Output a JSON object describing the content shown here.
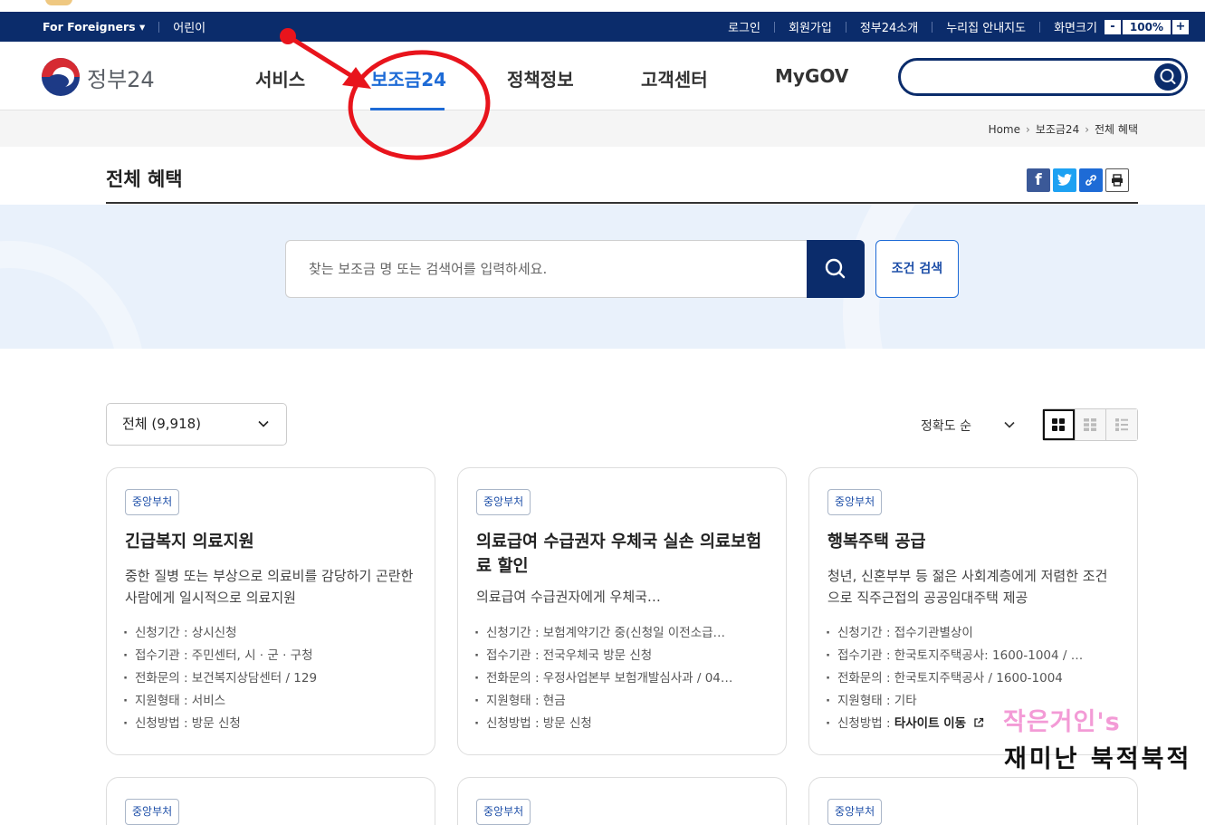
{
  "util_bar": {
    "foreigners": "For Foreigners ▾",
    "kids": "어린이",
    "login": "로그인",
    "signup": "회원가입",
    "about": "정부24소개",
    "sitemap": "누리집 안내지도",
    "zoom_label": "화면크기",
    "zoom_minus": "-",
    "zoom_value": "100%",
    "zoom_plus": "+"
  },
  "header": {
    "logo_text": "정부24",
    "menu": [
      "서비스",
      "보조금24",
      "정책정보",
      "고객센터",
      "MyGOV"
    ],
    "active_index": 1
  },
  "breadcrumb": {
    "home": "Home",
    "level1": "보조금24",
    "level2": "전체 혜택"
  },
  "page_title": "전체 혜택",
  "search": {
    "placeholder": "찾는 보조금 명 또는 검색어를 입력하세요.",
    "cond_button": "조건 검색"
  },
  "filter": {
    "category_selected": "전체 (9,918)",
    "sort_selected": "정확도 순"
  },
  "cards": [
    {
      "badge": "중앙부처",
      "title": "긴급복지 의료지원",
      "desc": "중한 질병 또는 부상으로 의료비를 감당하기 곤란한 사람에게 일시적으로 의료지원",
      "period": "신청기간 : 상시신청",
      "agency": "접수기관 : 주민센터, 시 · 군 · 구청",
      "phone": "전화문의 : 보건복지상담센터 / 129",
      "type": "지원형태 : 서비스",
      "method": "신청방법 : 방문 신청"
    },
    {
      "badge": "중앙부처",
      "title": "의료급여 수급권자 우체국 실손 의료보험료 할인",
      "desc": "의료급여 수급권자에게 우체국…",
      "period": "신청기간 : 보험계약기간 중(신청일 이전소급…",
      "agency": "접수기관 : 전국우체국 방문 신청",
      "phone": "전화문의 : 우정사업본부 보험개발심사과 / 04…",
      "type": "지원형태 : 현금",
      "method": "신청방법 : 방문 신청"
    },
    {
      "badge": "중앙부처",
      "title": "행복주택 공급",
      "desc": "청년, 신혼부부 등 젊은 사회계층에게 저렴한 조건으로 직주근접의 공공임대주택 제공",
      "period": "신청기간 : 접수기관별상이",
      "agency": "접수기관 : 한국토지주택공사: 1600-1004 / …",
      "phone": "전화문의 : 한국토지주택공사 / 1600-1004",
      "type": "지원형태 : 기타",
      "method_label": "신청방법 : ",
      "method_link": "타사이트 이동"
    }
  ],
  "stub_cards": [
    {
      "badge": "중앙부처"
    },
    {
      "badge": "중앙부처"
    },
    {
      "badge": "중앙부처"
    }
  ],
  "watermark": {
    "line1": "작은거인's",
    "line2": "재미난 북적북적"
  },
  "colors": {
    "navy": "#0b2c6b",
    "accent_blue": "#1e6bd6",
    "annotation_red": "#e8141c",
    "watermark_pink": "#f39bd6"
  }
}
